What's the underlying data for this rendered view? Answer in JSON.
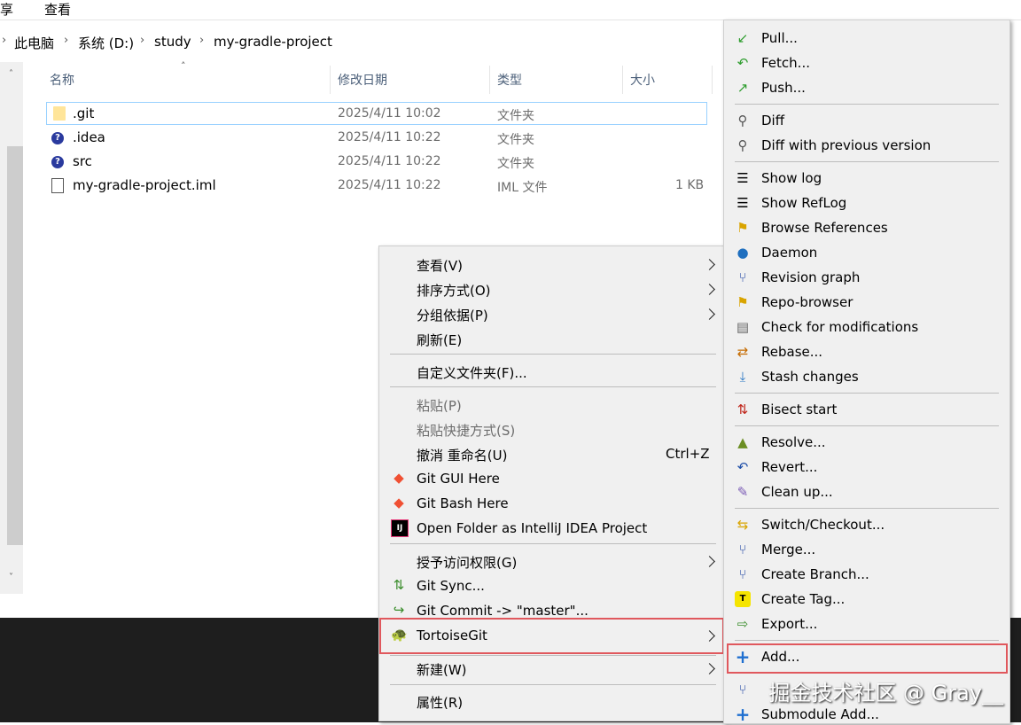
{
  "ribbon": {
    "tabs": [
      "享",
      "查看"
    ]
  },
  "breadcrumb": [
    "此电脑",
    "系统 (D:)",
    "study",
    "my-gradle-project"
  ],
  "columns": {
    "name": "名称",
    "date": "修改日期",
    "type": "类型",
    "size": "大小"
  },
  "files": [
    {
      "name": ".git",
      "date": "2025/4/11 10:02",
      "type": "文件夹",
      "size": ""
    },
    {
      "name": ".idea",
      "date": "2025/4/11 10:22",
      "type": "文件夹",
      "size": ""
    },
    {
      "name": "src",
      "date": "2025/4/11 10:22",
      "type": "文件夹",
      "size": ""
    },
    {
      "name": "my-gradle-project.iml",
      "date": "2025/4/11 10:22",
      "type": "IML 文件",
      "size": "1 KB"
    }
  ],
  "context_menu": {
    "view": "查看(V)",
    "sort": "排序方式(O)",
    "group": "分组依据(P)",
    "refresh": "刷新(E)",
    "customize": "自定义文件夹(F)...",
    "paste": "粘贴(P)",
    "paste_shortcut": "粘贴快捷方式(S)",
    "undo": "撤消 重命名(U)",
    "undo_shortcut": "Ctrl+Z",
    "git_gui": "Git GUI Here",
    "git_bash": "Git Bash Here",
    "intellij": "Open Folder as IntelliJ IDEA Project",
    "grant_access": "授予访问权限(G)",
    "git_sync": "Git Sync...",
    "git_commit": "Git Commit -> \"master\"...",
    "tortoisegit": "TortoiseGit",
    "new": "新建(W)",
    "properties": "属性(R)"
  },
  "tortoise_menu": {
    "pull": "Pull...",
    "fetch": "Fetch...",
    "push": "Push...",
    "diff": "Diff",
    "diff_prev": "Diff with previous version",
    "show_log": "Show log",
    "show_reflog": "Show RefLog",
    "browse_refs": "Browse References",
    "daemon": "Daemon",
    "revision_graph": "Revision graph",
    "repo_browser": "Repo-browser",
    "check_mods": "Check for modifications",
    "rebase": "Rebase...",
    "stash": "Stash changes",
    "bisect": "Bisect start",
    "resolve": "Resolve...",
    "revert": "Revert...",
    "cleanup": "Clean up...",
    "switch": "Switch/Checkout...",
    "merge": "Merge...",
    "create_branch": "Create Branch...",
    "create_tag": "Create Tag...",
    "export": "Export...",
    "add": "Add...",
    "submodule_add": "Submodule Add..."
  },
  "watermark": "掘金技术社区 @ Gray__",
  "colors": {
    "highlight_border": "#e0585d",
    "selection_border": "#99d1ff",
    "menu_bg": "#f0f0f0"
  }
}
